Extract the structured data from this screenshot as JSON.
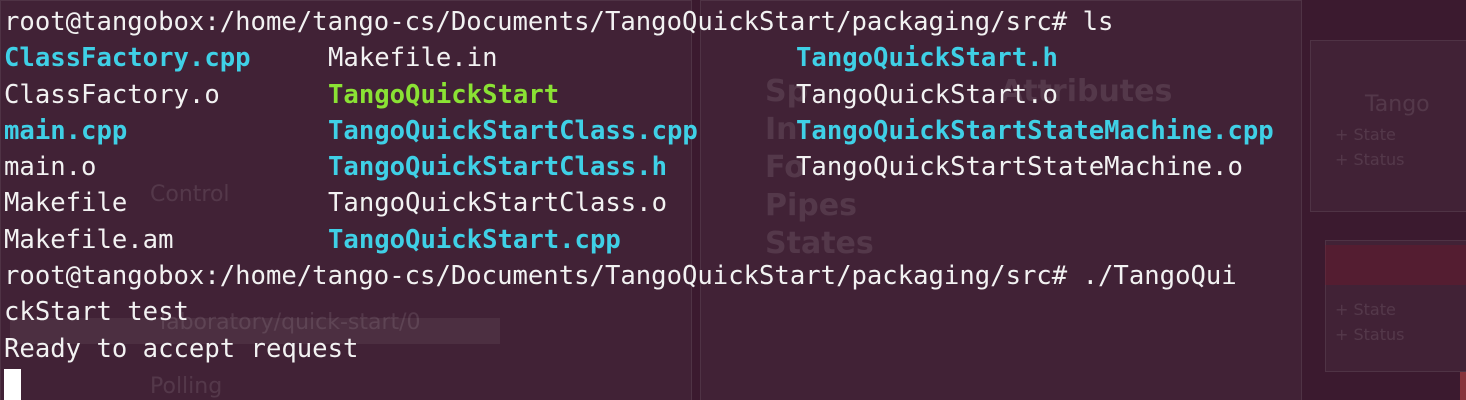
{
  "terminal": {
    "prompt1": "root@tangobox:/home/tango-cs/Documents/TangoQuickStart/packaging/src# ls",
    "listing": [
      [
        {
          "text": "ClassFactory.cpp",
          "style": "cyan"
        },
        {
          "text": "Makefile.in",
          "style": "plain"
        },
        {
          "text": "TangoQuickStart.h",
          "style": "cyan"
        }
      ],
      [
        {
          "text": "ClassFactory.o",
          "style": "plain"
        },
        {
          "text": "TangoQuickStart",
          "style": "green"
        },
        {
          "text": "TangoQuickStart.o",
          "style": "plain"
        }
      ],
      [
        {
          "text": "main.cpp",
          "style": "cyan"
        },
        {
          "text": "TangoQuickStartClass.cpp",
          "style": "cyan"
        },
        {
          "text": "TangoQuickStartStateMachine.cpp",
          "style": "cyan"
        }
      ],
      [
        {
          "text": "main.o",
          "style": "plain"
        },
        {
          "text": "TangoQuickStartClass.h",
          "style": "cyan"
        },
        {
          "text": "TangoQuickStartStateMachine.o",
          "style": "plain"
        }
      ],
      [
        {
          "text": "Makefile",
          "style": "plain"
        },
        {
          "text": "TangoQuickStartClass.o",
          "style": "plain"
        },
        {
          "text": "",
          "style": "plain"
        }
      ],
      [
        {
          "text": "Makefile.am",
          "style": "plain"
        },
        {
          "text": "TangoQuickStart.cpp",
          "style": "cyan"
        },
        {
          "text": "",
          "style": "plain"
        }
      ]
    ],
    "prompt2_line1": "root@tangobox:/home/tango-cs/Documents/TangoQuickStart/packaging/src# ./TangoQui",
    "prompt2_line2": "ckStart test",
    "output": "Ready to accept request"
  },
  "colors": {
    "background": "#3b1a2f",
    "text": "#f2f2f2",
    "source_file": "#3fd0e6",
    "executable": "#8ae234"
  }
}
